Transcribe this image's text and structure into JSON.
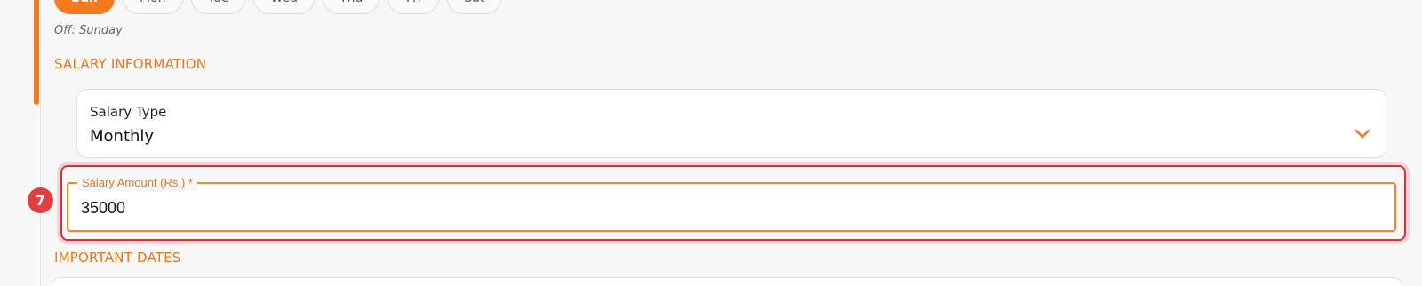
{
  "schedule": {
    "days": [
      {
        "label": "Sun",
        "active": true
      },
      {
        "label": "Mon",
        "active": false
      },
      {
        "label": "Tue",
        "active": false
      },
      {
        "label": "Wed",
        "active": false
      },
      {
        "label": "Thu",
        "active": false
      },
      {
        "label": "Fri",
        "active": false
      },
      {
        "label": "Sat",
        "active": false
      }
    ],
    "off_note": "Off: Sunday"
  },
  "salary_section": {
    "heading": "SALARY INFORMATION",
    "salary_type": {
      "label": "Salary Type",
      "value": "Monthly",
      "icon": "chevron-down-icon"
    },
    "salary_amount": {
      "label": "Salary Amount (Rs.) *",
      "value": "35000",
      "step_badge": "7"
    }
  },
  "dates_section": {
    "heading": "IMPORTANT DATES"
  },
  "colors": {
    "accent": "#f07b1e",
    "highlight": "#d9303b",
    "badge": "#e03f3f"
  }
}
